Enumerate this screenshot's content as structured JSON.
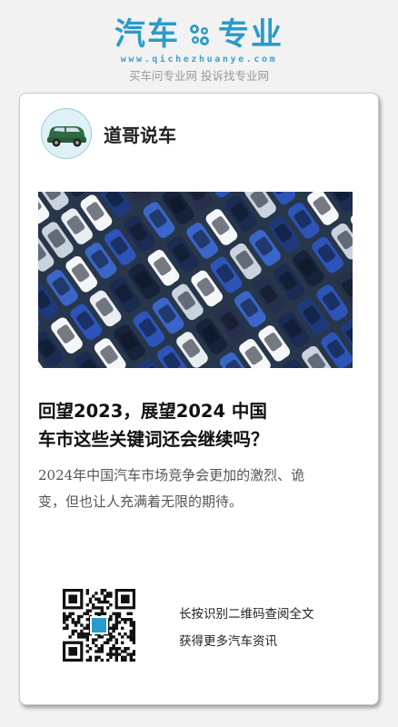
{
  "brand": {
    "name_left": "汽车",
    "name_right": "专业",
    "url": "www.qichezhuanye.com",
    "slogan": "买车问专业网 投诉找专业网",
    "color": "#2b9bc9"
  },
  "author": {
    "name": "道哥说车",
    "avatar_icon": "car-avatar-icon"
  },
  "article": {
    "hero_image": "aerial-parking-lot-cars",
    "title_line1": "回望2023，展望2024 中国",
    "title_line2": "车市这些关键词还会继续吗？",
    "summary_line1": "2024年中国汽车市场竞争会更加的激烈、诡",
    "summary_line2": "变，但也让人充满着无限的期待。"
  },
  "share": {
    "qr_icon": "qr-code-icon",
    "line1": "长按识别二维码查阅全文",
    "line2": "获得更多汽车资讯"
  }
}
